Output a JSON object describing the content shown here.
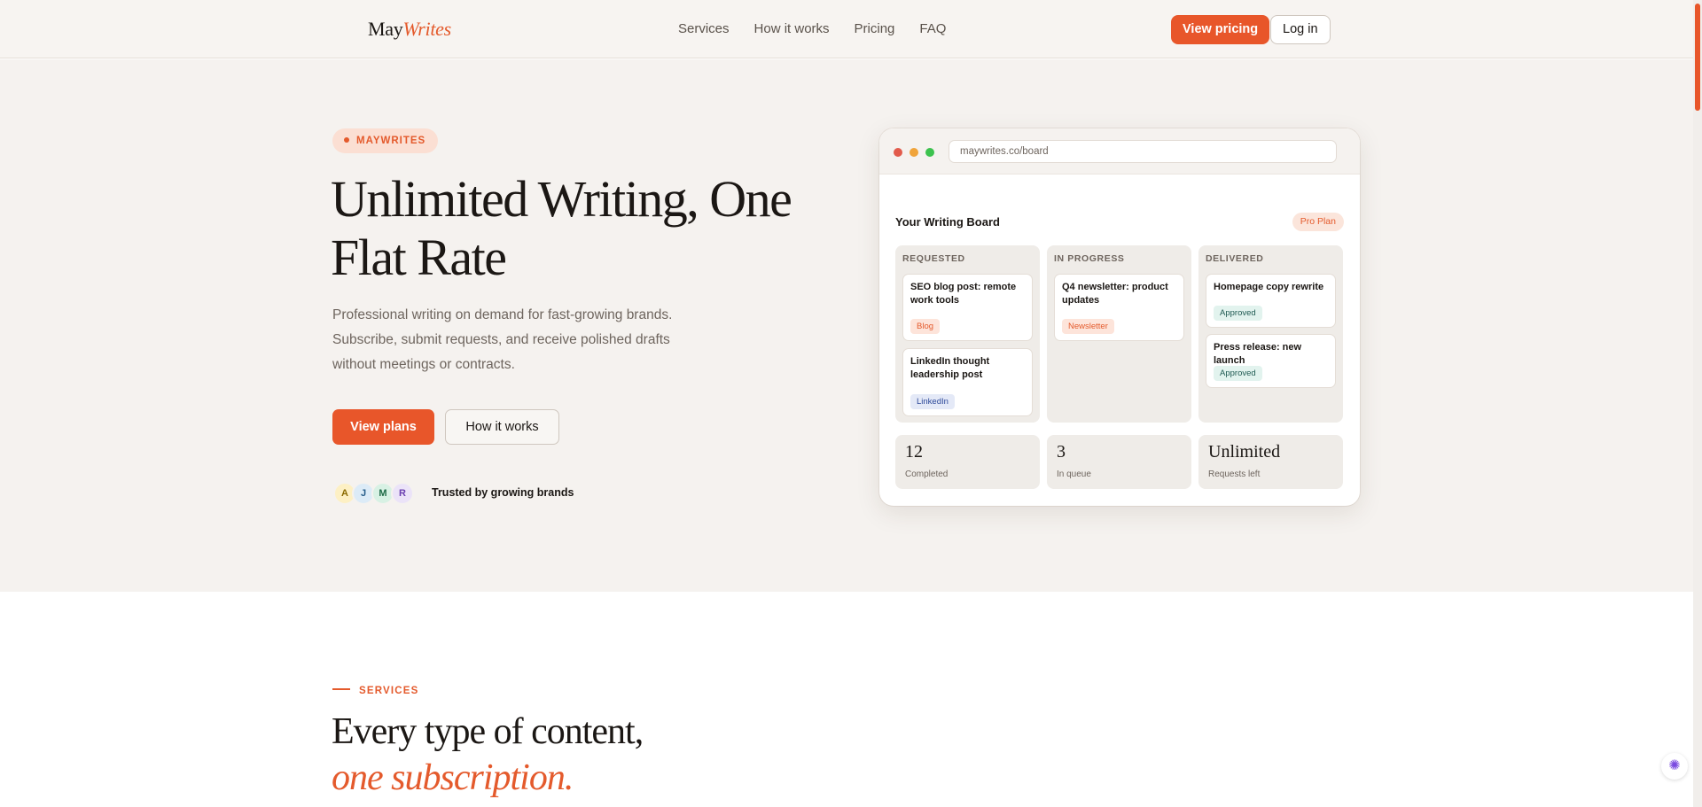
{
  "nav": {
    "logo_main": "May",
    "logo_accent": "Writes",
    "links": [
      "Services",
      "How it works",
      "Pricing",
      "FAQ"
    ],
    "view_pricing": "View pricing",
    "log_in": "Log in"
  },
  "hero": {
    "badge": "MAYWRITES",
    "title": "Unlimited Writing, One Flat Rate",
    "description": "Professional writing on demand for fast-growing brands. Subscribe, submit requests, and receive polished drafts without meetings or contracts.",
    "btn_plans": "View plans",
    "btn_how": "How it works",
    "avatars": [
      "A",
      "J",
      "M",
      "R"
    ],
    "trusted": "Trusted by growing brands"
  },
  "board": {
    "url": "maywrites.co/board",
    "title": "Your Writing Board",
    "plan": "Pro Plan",
    "columns": [
      {
        "title": "REQUESTED",
        "cards": [
          {
            "title": "SEO blog post: remote work tools",
            "tag": "Blog"
          },
          {
            "title": "LinkedIn thought leadership post",
            "tag": "LinkedIn"
          }
        ]
      },
      {
        "title": "IN PROGRESS",
        "cards": [
          {
            "title": "Q4 newsletter: product updates",
            "tag": "Newsletter"
          }
        ]
      },
      {
        "title": "DELIVERED",
        "cards": [
          {
            "title": "Homepage copy rewrite",
            "tag": "Approved"
          },
          {
            "title": "Press release: new launch",
            "tag": "Approved"
          }
        ]
      }
    ],
    "stats": [
      {
        "value": "12",
        "label": "Completed"
      },
      {
        "value": "3",
        "label": "In queue"
      },
      {
        "value": "Unlimited",
        "label": "Requests left"
      }
    ]
  },
  "services": {
    "eyebrow": "SERVICES",
    "title_line1": "Every type of content,",
    "title_line2": "one subscription."
  },
  "colors": {
    "accent": "#e8562a",
    "hero_bg": "#f5f2ef",
    "tag_blog": "#fde4da",
    "tag_linkedin": "#e4e9f7",
    "tag_approved": "#e2f3ee"
  }
}
